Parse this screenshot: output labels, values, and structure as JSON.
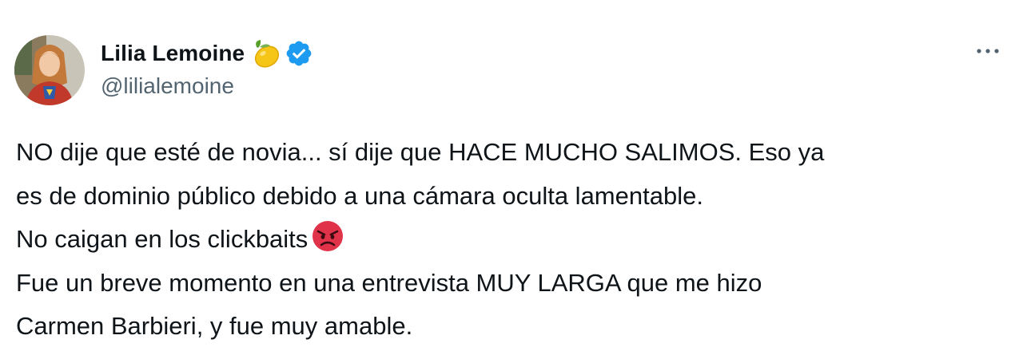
{
  "author": {
    "display_name": "Lilia Lemoine",
    "handle": "@lilialemoine",
    "name_emoji": "lemon-icon",
    "verified_color": "#1d9bf0"
  },
  "tweet": {
    "lines": [
      "NO dije que esté de novia... sí dije que HACE MUCHO SALIMOS. Eso ya",
      "es de dominio público debido a una cámara oculta lamentable.",
      "No caigan en los clickbaits",
      "Fue un breve momento en una entrevista MUY LARGA que me hizo",
      "Carmen Barbieri, y fue muy amable."
    ],
    "inline_emoji": "angry-face-icon"
  },
  "colors": {
    "text": "#0f1419",
    "secondary": "#536471",
    "accent": "#1d9bf0"
  }
}
